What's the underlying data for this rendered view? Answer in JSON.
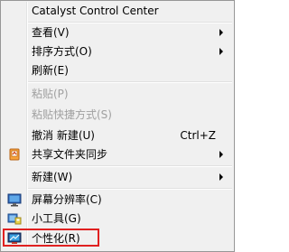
{
  "menu": {
    "items": [
      {
        "label": "Catalyst Control Center"
      },
      {
        "label": "查看(V)"
      },
      {
        "label": "排序方式(O)"
      },
      {
        "label": "刷新(E)"
      },
      {
        "label": "粘贴(P)"
      },
      {
        "label": "粘贴快捷方式(S)"
      },
      {
        "label": "撤消 新建(U)",
        "shortcut": "Ctrl+Z"
      },
      {
        "label": "共享文件夹同步"
      },
      {
        "label": "新建(W)"
      },
      {
        "label": "屏幕分辨率(C)"
      },
      {
        "label": "小工具(G)"
      },
      {
        "label": "个性化(R)"
      }
    ]
  },
  "colors": {
    "highlight_border": "#e02020",
    "disabled_text": "#a0a0a0"
  },
  "icons": {
    "sync": "sync-icon",
    "display": "display-icon",
    "gadgets": "gadgets-icon",
    "personalize": "personalize-icon"
  }
}
